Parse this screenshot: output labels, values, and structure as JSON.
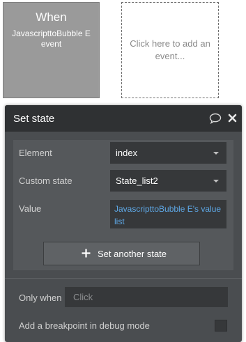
{
  "when_card": {
    "title": "When",
    "subtitle": "JavascripttoBubble E event"
  },
  "add_event": {
    "label": "Click here to add an event..."
  },
  "panel": {
    "title": "Set state",
    "element": {
      "label": "Element",
      "value": "index"
    },
    "custom_state": {
      "label": "Custom state",
      "value": "State_list2"
    },
    "value_field": {
      "label": "Value",
      "value": "JavascripttoBubble E's value list"
    },
    "set_another_label": "Set another state",
    "only_when": {
      "label": "Only when",
      "placeholder": "Click"
    },
    "breakpoint": {
      "label": "Add a breakpoint in debug mode",
      "checked": false
    }
  },
  "colors": {
    "panel_bg": "#4a4d50",
    "header_bg": "#2f3133",
    "input_bg": "#36383a",
    "link_blue": "#5ea8e6",
    "event_card": "#9a9a9a"
  },
  "icons": [
    "comment-icon",
    "close-icon",
    "plus-icon",
    "chevron-down-icon"
  ]
}
